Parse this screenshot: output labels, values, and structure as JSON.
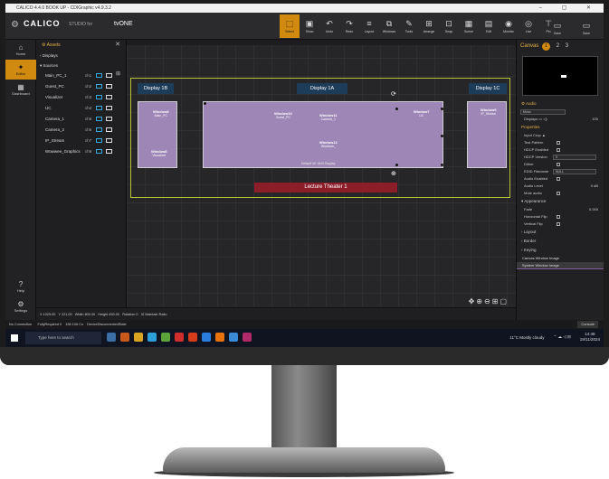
{
  "window": {
    "title": "CALICO 4.4.0 BOOK UP - CDIGraphic v4.9.3.2",
    "controls": "– ▢ ✕"
  },
  "brand": {
    "name": "CALICO",
    "sub": "STUDIO for",
    "partner": "tvONE"
  },
  "toolbar": {
    "tools": [
      {
        "label": "Select",
        "icon": "⬚",
        "active": true
      },
      {
        "label": "Show",
        "icon": "▣"
      },
      {
        "label": "Undo",
        "icon": "↶"
      },
      {
        "label": "Redo",
        "icon": "↷"
      },
      {
        "label": "Layout",
        "icon": "≡"
      },
      {
        "label": "Windows",
        "icon": "⧉"
      },
      {
        "label": "Tools",
        "icon": "✎"
      },
      {
        "label": "Arrange",
        "icon": "⊞"
      },
      {
        "label": "Snap",
        "icon": "⊡"
      },
      {
        "label": "Scene",
        "icon": "▦"
      },
      {
        "label": "Edit",
        "icon": "▤"
      },
      {
        "label": "Monitor",
        "icon": "◉"
      },
      {
        "label": "Live",
        "icon": "◎"
      },
      {
        "label": "Pin",
        "icon": "⊤"
      }
    ],
    "right_tools": [
      {
        "label": "Save",
        "icon": "▭"
      },
      {
        "label": "Save",
        "icon": "▭"
      }
    ]
  },
  "rail": {
    "items": [
      {
        "label": "Home",
        "icon": "⌂"
      },
      {
        "label": "Editor",
        "icon": "✦",
        "active": true
      },
      {
        "label": "Dashboard",
        "icon": "▦"
      }
    ],
    "bottom": [
      {
        "label": "Help",
        "icon": "?"
      },
      {
        "label": "Settings",
        "icon": "⚙"
      }
    ]
  },
  "assets": {
    "title": "Assets",
    "groups": [
      "Displays",
      "Sources"
    ],
    "sources": [
      {
        "name": "Main_PC_1",
        "ch": "ch1"
      },
      {
        "name": "Guest_PC",
        "ch": "ch2"
      },
      {
        "name": "Visualizer",
        "ch": "ch3"
      },
      {
        "name": "UC",
        "ch": "ch4"
      },
      {
        "name": "Camera_1",
        "ch": "ch5"
      },
      {
        "name": "Camera_2",
        "ch": "ch6"
      },
      {
        "name": "IP_Stream",
        "ch": "ch7"
      },
      {
        "name": "Wowwee_Graphics",
        "ch": "ch8"
      }
    ]
  },
  "canvas": {
    "displays": [
      {
        "label": "Display 1B"
      },
      {
        "label": "Display 1A"
      },
      {
        "label": "Display 1C"
      }
    ],
    "windows": [
      {
        "title": "Window10",
        "source": "Guest_PC"
      },
      {
        "title": "Window11",
        "source": "Camera_1"
      },
      {
        "title": "Window12",
        "source": "Wowwee_"
      },
      {
        "title": "Window7",
        "source": "UC"
      },
      {
        "title": "Window8",
        "source": "Visualizer"
      },
      {
        "title": "Window8",
        "source": "Main_PC"
      },
      {
        "title": "Window9",
        "source": "IP_Stream"
      }
    ],
    "default_layout": "Default 4K 16x9 Display",
    "room_label": "Lecture Theater 1"
  },
  "properties_strip": {
    "x_label": "X",
    "x_value": "1025.00",
    "y_label": "Y",
    "y_value": "221.00",
    "width_label": "Width",
    "width_value": "800.00",
    "height_label": "Height",
    "height_value": "450.00",
    "rotation_label": "Rotation",
    "rotation_value": "0",
    "maintain_ratio": "Maintain Ratio"
  },
  "status": {
    "connection": "No Connection",
    "required": "FullyRequired 0",
    "memory": "138 106 Cn",
    "device": "DeviceDisconnectedState",
    "console": "Console"
  },
  "right_panel": {
    "tab_label": "Canvas",
    "tabs": [
      "1",
      "2",
      "3"
    ],
    "audio": "Audio",
    "audio_mode": "Mono",
    "displays_label": "Displays",
    "volume": "100",
    "properties_title": "Properties",
    "input_crop": "Input Crop",
    "rows": [
      {
        "label": "Test Pattern"
      },
      {
        "label": "HDCP Enabled"
      },
      {
        "label": "HDCP Version",
        "field": "0"
      },
      {
        "label": "Dither"
      },
      {
        "label": "EDID Filename",
        "field": "NULL"
      },
      {
        "label": "Audio Enabled"
      },
      {
        "label": "Audio Level",
        "value": "0 dB"
      },
      {
        "label": "Mute audio"
      }
    ],
    "appearance": "Appearance",
    "app_rows": [
      {
        "label": "Fade",
        "value": "0.000"
      },
      {
        "label": "Horizontal Flip"
      },
      {
        "label": "Vertical Flip"
      }
    ],
    "collapsed": [
      "Layout",
      "Border",
      "Keying"
    ],
    "canvas_window_image": "Canvas Window Image",
    "system_window_image": "System Window Image"
  },
  "taskbar": {
    "search_placeholder": "Type here to search",
    "weather": "11°C Mostly cloudy",
    "time": "14:48",
    "date": "19/11/2024",
    "icon_colors": [
      "#3a6ea5",
      "#c75a1a",
      "#d9a520",
      "#2c9fd9",
      "#5ba33a",
      "#d12d2d",
      "#d63b1a",
      "#2a7de1",
      "#e8720c",
      "#3a8ad6",
      "#b02a6a"
    ]
  }
}
